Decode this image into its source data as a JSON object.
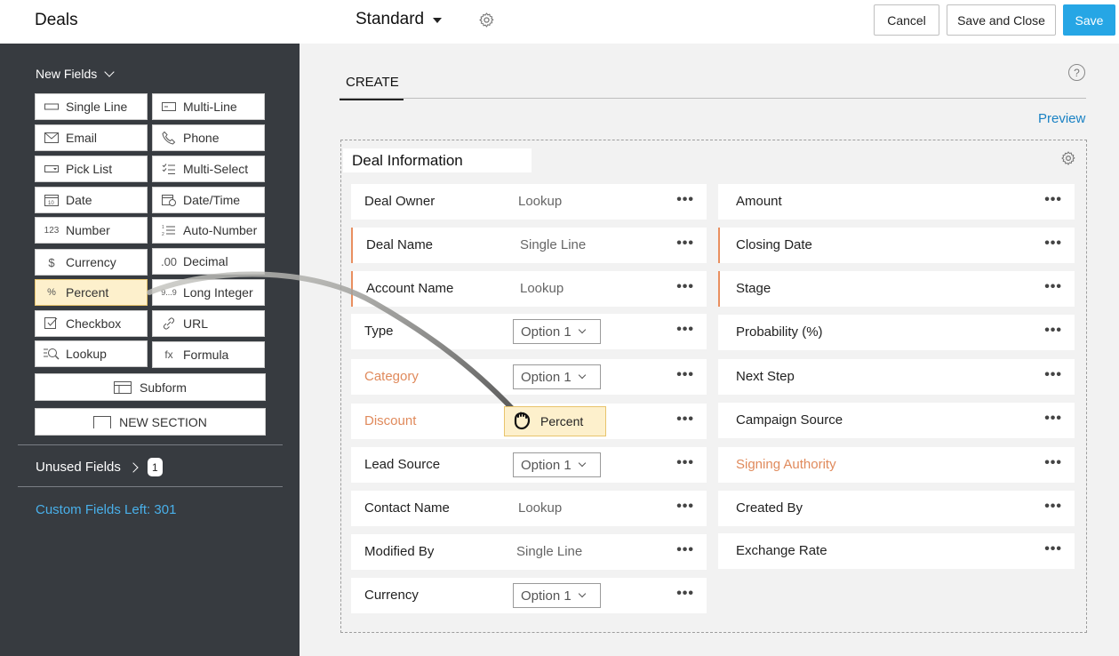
{
  "header": {
    "title": "Deals",
    "layout": "Standard",
    "buttons": {
      "cancel": "Cancel",
      "save_close": "Save and Close",
      "save": "Save"
    }
  },
  "sidebar": {
    "section_title": "New Fields",
    "fields": [
      {
        "label": "Single Line",
        "icon": "single-line-icon"
      },
      {
        "label": "Multi-Line",
        "icon": "multi-line-icon"
      },
      {
        "label": "Email",
        "icon": "email-icon"
      },
      {
        "label": "Phone",
        "icon": "phone-icon"
      },
      {
        "label": "Pick List",
        "icon": "pick-list-icon"
      },
      {
        "label": "Multi-Select",
        "icon": "multi-select-icon"
      },
      {
        "label": "Date",
        "icon": "date-icon"
      },
      {
        "label": "Date/Time",
        "icon": "date-time-icon"
      },
      {
        "label": "Number",
        "icon": "number-icon",
        "glyph": "123"
      },
      {
        "label": "Auto-Number",
        "icon": "auto-number-icon"
      },
      {
        "label": "Currency",
        "icon": "currency-icon",
        "glyph": "$"
      },
      {
        "label": "Decimal",
        "icon": "decimal-icon",
        "glyph": ".00"
      },
      {
        "label": "Percent",
        "icon": "percent-icon",
        "glyph": "%"
      },
      {
        "label": "Long Integer",
        "icon": "long-integer-icon",
        "glyph": "9...9"
      },
      {
        "label": "Checkbox",
        "icon": "checkbox-icon"
      },
      {
        "label": "URL",
        "icon": "url-icon"
      },
      {
        "label": "Lookup",
        "icon": "lookup-icon"
      },
      {
        "label": "Formula",
        "icon": "formula-icon",
        "glyph": "fx"
      }
    ],
    "subform": "Subform",
    "new_section": "NEW SECTION",
    "unused_fields": "Unused Fields",
    "unused_count": "1",
    "custom_fields_left": "Custom Fields Left: 301"
  },
  "main": {
    "tab": "CREATE",
    "help": "?",
    "preview": "Preview",
    "section_title": "Deal Information",
    "left_fields": [
      {
        "label": "Deal Owner",
        "type": "Lookup"
      },
      {
        "label": "Deal Name",
        "type": "Single Line"
      },
      {
        "label": "Account Name",
        "type": "Lookup"
      },
      {
        "label": "Type",
        "select": "Option 1"
      },
      {
        "label": "Category",
        "select": "Option 1"
      },
      {
        "label": "Discount",
        "dropped": "Percent"
      },
      {
        "label": "Lead Source",
        "select": "Option 1"
      },
      {
        "label": "Contact Name",
        "type": "Lookup"
      },
      {
        "label": "Modified By",
        "type": "Single Line"
      },
      {
        "label": "Currency",
        "select": "Option 1"
      }
    ],
    "right_fields": [
      {
        "label": "Amount"
      },
      {
        "label": "Closing Date"
      },
      {
        "label": "Stage"
      },
      {
        "label": "Probability (%)"
      },
      {
        "label": "Next Step"
      },
      {
        "label": "Campaign Source"
      },
      {
        "label": "Signing Authority"
      },
      {
        "label": "Created By"
      },
      {
        "label": "Exchange Rate"
      }
    ],
    "more": "•••"
  }
}
